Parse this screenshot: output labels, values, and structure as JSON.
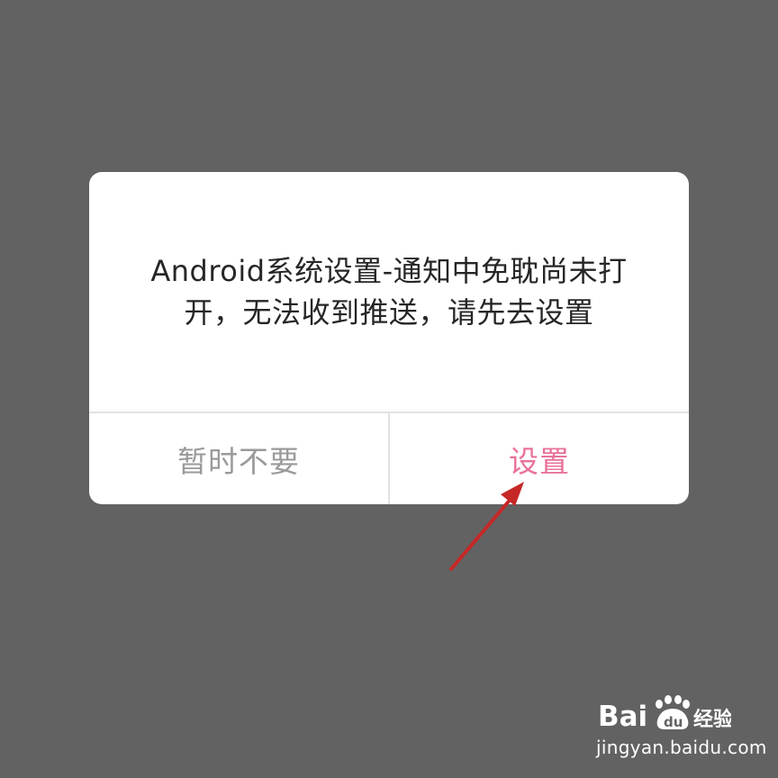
{
  "dialog": {
    "message": "Android系统设置-通知中免耽尚未打开，无法收到推送，请先去设置",
    "cancel_label": "暂时不要",
    "confirm_label": "设置"
  },
  "watermark": {
    "brand": "Bai du 经验",
    "url": "jingyan.baidu.com"
  },
  "colors": {
    "backdrop": "#626262",
    "dialog_bg": "#ffffff",
    "cancel_text": "#9a9a9a",
    "confirm_text": "#e8729b",
    "annotation_arrow": "#c62828"
  },
  "annotation": {
    "icon": "red-arrow-icon"
  }
}
